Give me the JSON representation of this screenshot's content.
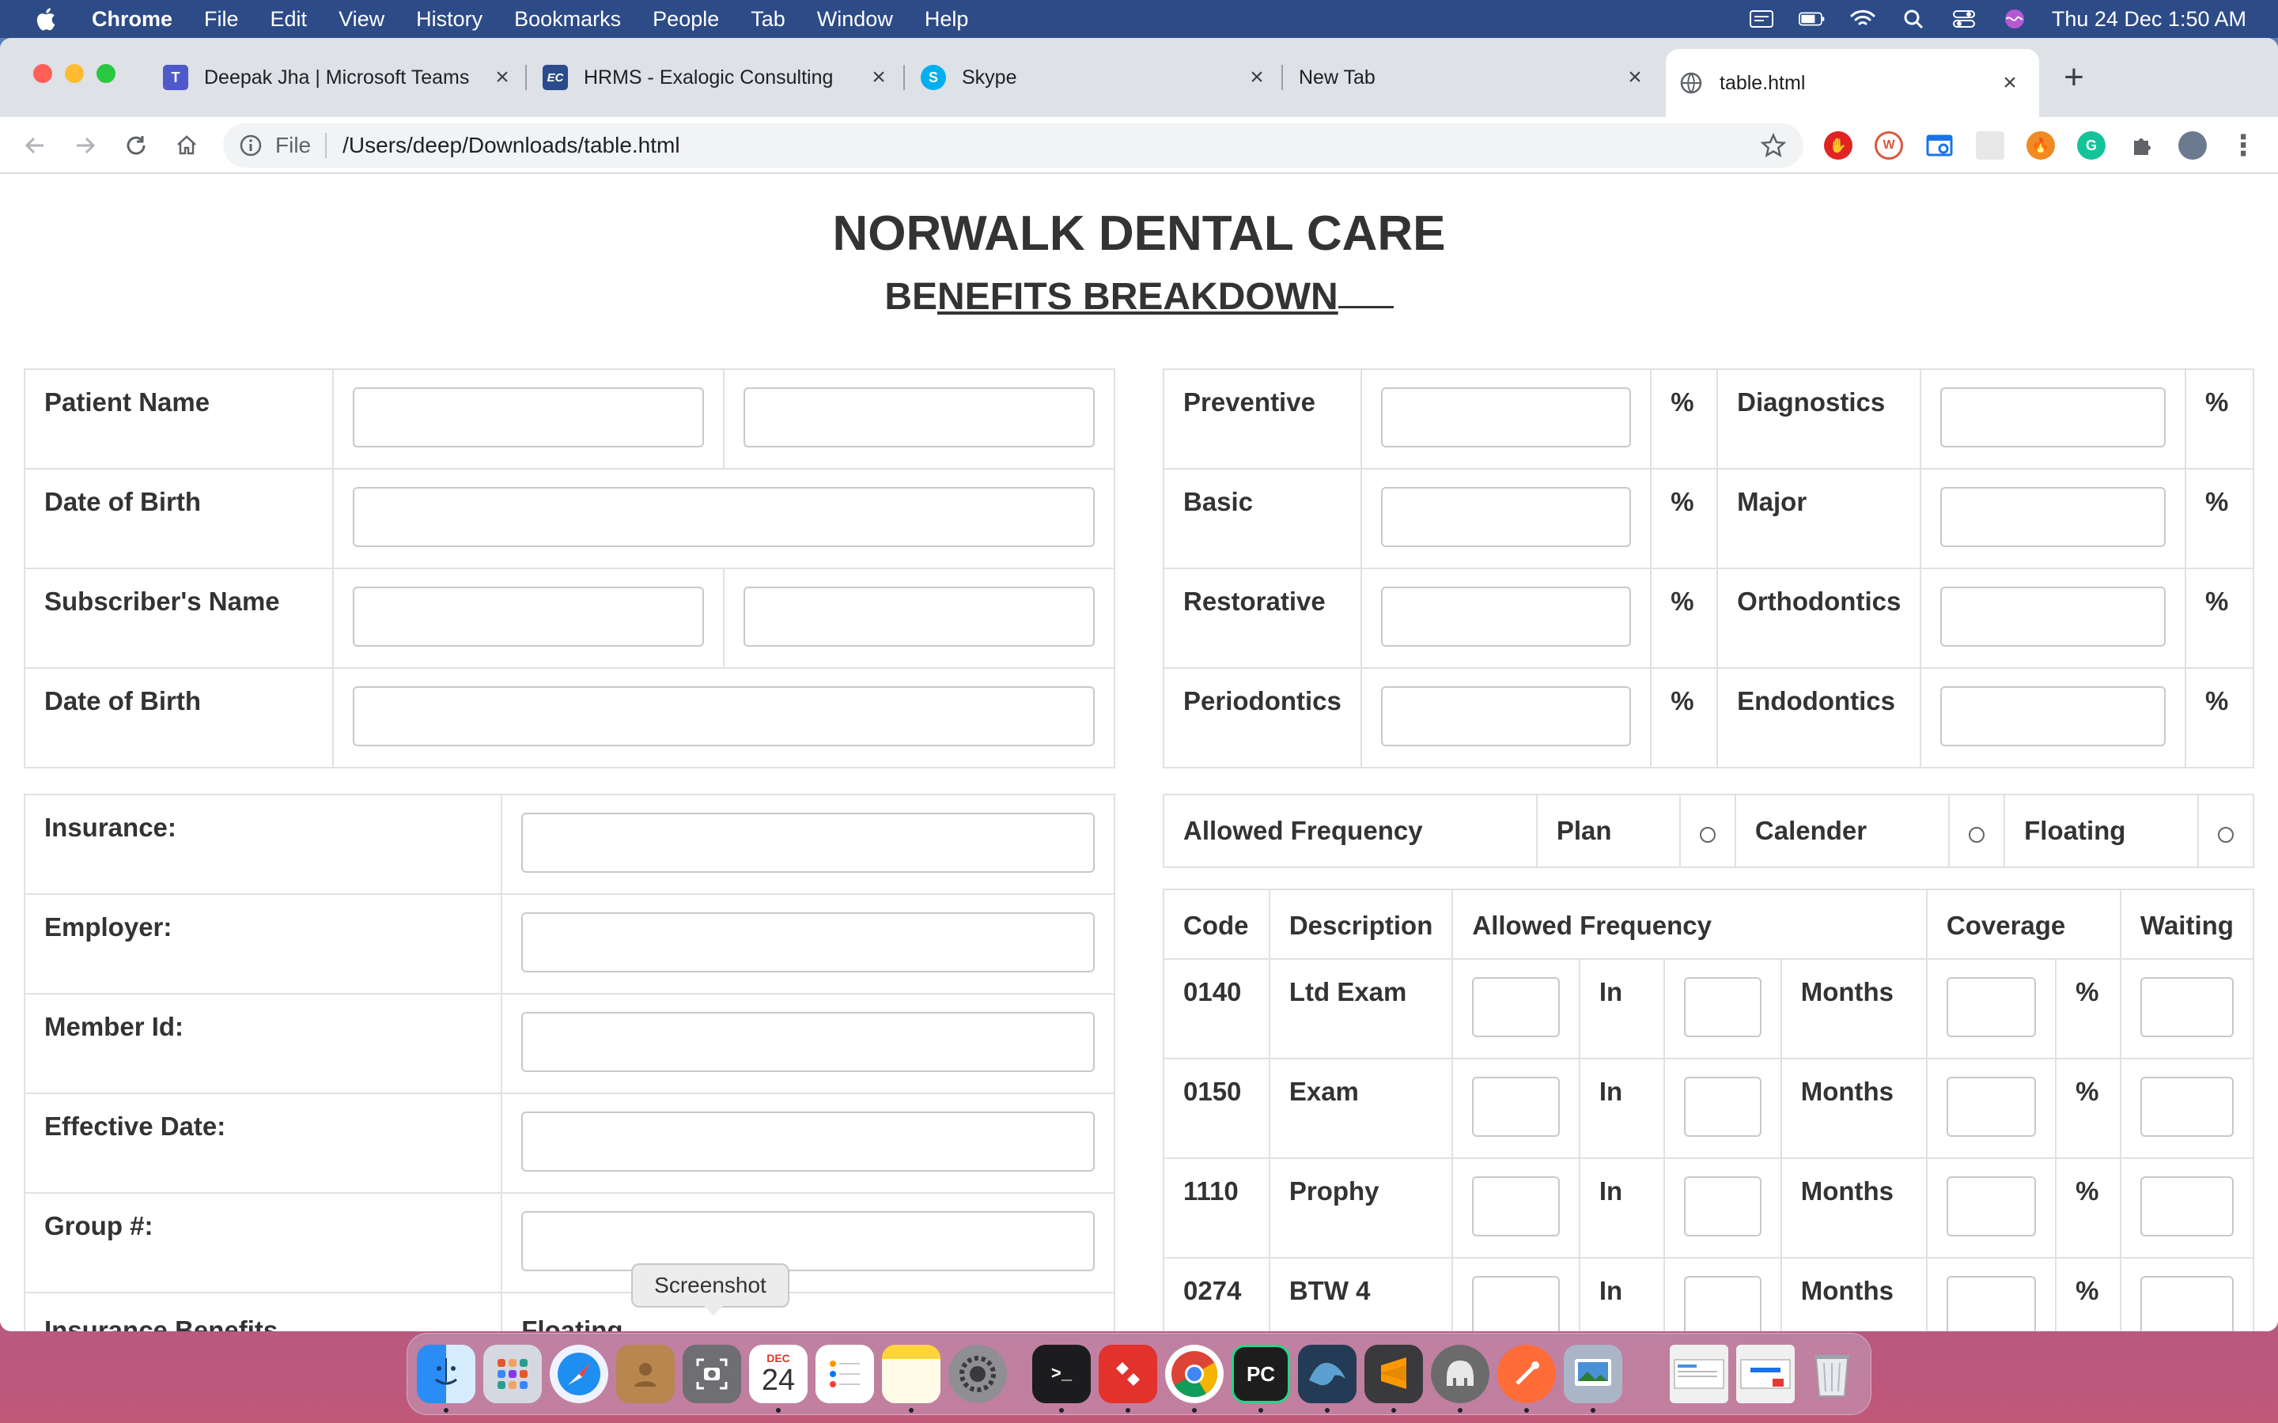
{
  "menubar": {
    "app": "Chrome",
    "items": [
      "File",
      "Edit",
      "View",
      "History",
      "Bookmarks",
      "People",
      "Tab",
      "Window",
      "Help"
    ],
    "clock": "Thu 24 Dec  1:50 AM"
  },
  "browser": {
    "tabs": [
      {
        "title": "Deepak Jha | Microsoft Teams",
        "icon": "teams-icon"
      },
      {
        "title": "HRMS - Exalogic Consulting",
        "icon": "ec-icon"
      },
      {
        "title": "Skype",
        "icon": "skype-icon"
      },
      {
        "title": "New Tab",
        "icon": ""
      },
      {
        "title": "table.html",
        "icon": "globe-icon"
      }
    ],
    "address": {
      "scheme": "File",
      "url": "/Users/deep/Downloads/table.html"
    }
  },
  "page": {
    "title": "NORWALK DENTAL CARE",
    "subtitle_plain": "BE",
    "subtitle_underlined": "NEFITS BREAKDOWN",
    "patient_table": {
      "rows": [
        "Patient Name",
        "Date of Birth",
        "Subscriber's Name",
        "Date of Birth"
      ]
    },
    "coverage_table": {
      "percent_symbol": "%",
      "rows": [
        {
          "left": "Preventive",
          "right": "Diagnostics"
        },
        {
          "left": "Basic",
          "right": "Major"
        },
        {
          "left": "Restorative",
          "right": "Orthodontics"
        },
        {
          "left": "Periodontics",
          "right": "Endodontics"
        }
      ]
    },
    "insurance_table": {
      "rows": [
        "Insurance:",
        "Employer:",
        "Member Id:",
        "Effective Date:",
        "Group #:"
      ],
      "benefits_label": "Insurance Benefits",
      "benefits_value": "Floating"
    },
    "frequency_header": {
      "label": "Allowed Frequency",
      "options": [
        "Plan",
        "Calender",
        "Floating"
      ]
    },
    "codes_table": {
      "headers": [
        "Code",
        "Description",
        "Allowed Frequency",
        "Coverage",
        "Waiting"
      ],
      "in_label": "In",
      "months_label": "Months",
      "percent_symbol": "%",
      "rows": [
        {
          "code": "0140",
          "description": "Ltd Exam"
        },
        {
          "code": "0150",
          "description": "Exam"
        },
        {
          "code": "1110",
          "description": "Prophy"
        },
        {
          "code": "0274",
          "description": "BTW 4"
        }
      ]
    }
  },
  "tooltip": "Screenshot",
  "dock": {
    "calendar_month": "DEC",
    "calendar_day": "24"
  }
}
